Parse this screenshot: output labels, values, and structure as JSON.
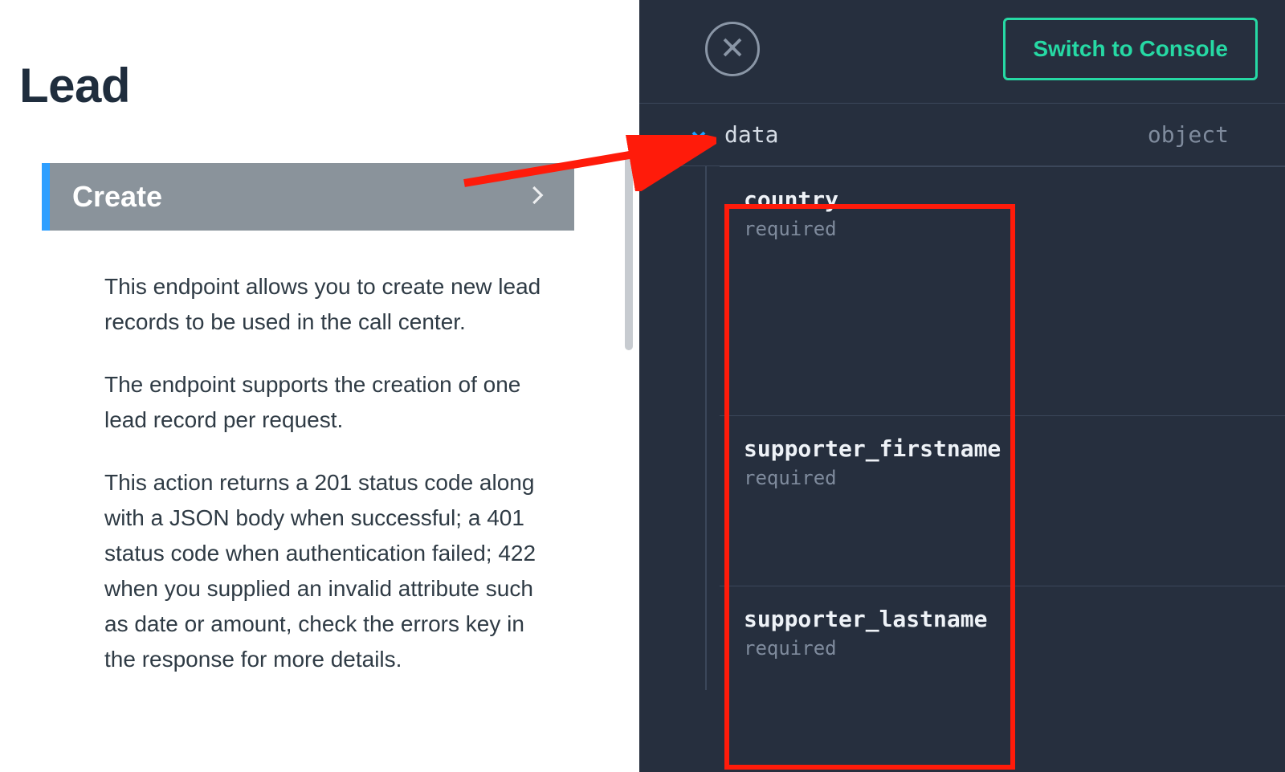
{
  "left": {
    "title": "Lead",
    "endpoint": {
      "label": "Create",
      "paragraphs": [
        "This endpoint allows you to create new lead records to be used in the call center.",
        "The endpoint supports the creation of one lead record per request.",
        "This action returns a 201 status code along with a JSON body when successful; a 401 status code when authentication failed; 422 when you supplied an invalid attribute such as date or amount, check the errors key in the response for more details."
      ]
    }
  },
  "right": {
    "close_icon": "close",
    "switch_btn": "Switch to Console",
    "schema": {
      "key": "data",
      "type": "object",
      "fields": [
        {
          "name": "country",
          "required_label": "required"
        },
        {
          "name": "supporter_firstname",
          "required_label": "required"
        },
        {
          "name": "supporter_lastname",
          "required_label": "required"
        }
      ]
    }
  },
  "colors": {
    "accent_blue": "#1ea1ff",
    "accent_green": "#26d9a4",
    "annotation_red": "#ff1b0a",
    "dark_bg": "#262f3e"
  }
}
